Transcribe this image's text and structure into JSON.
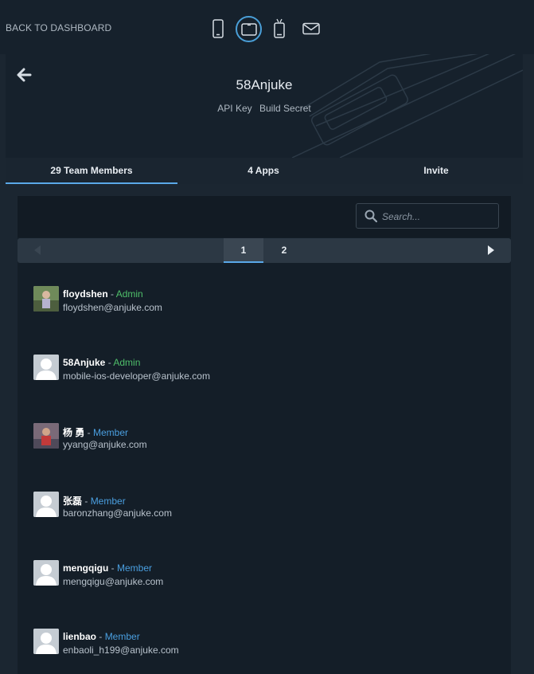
{
  "topbar": {
    "back_label": "BACK TO DASHBOARD",
    "device_icons": [
      "phone-icon",
      "tablet-icon",
      "android-icon",
      "mail-icon"
    ],
    "active_device": "tablet-icon"
  },
  "app": {
    "title": "58Anjuke",
    "api_key_label": "API Key",
    "build_secret_label": "Build Secret"
  },
  "tabs": [
    {
      "label": "29 Team Members",
      "active": true
    },
    {
      "label": "4 Apps",
      "active": false
    },
    {
      "label": "Invite",
      "active": false
    }
  ],
  "search": {
    "placeholder": "Search..."
  },
  "pagination": {
    "pages": [
      "1",
      "2"
    ],
    "current": "1"
  },
  "members": [
    {
      "name": "floydshen",
      "separator": " - ",
      "role": "Admin",
      "email": "floydshen@anjuke.com",
      "avatar": "photo"
    },
    {
      "name": "58Anjuke",
      "separator": " - ",
      "role": "Admin",
      "email": "mobile-ios-developer@anjuke.com",
      "avatar": "default"
    },
    {
      "name": "杨 勇",
      "separator": " - ",
      "role": "Member",
      "email": "yyang@anjuke.com",
      "avatar": "photo"
    },
    {
      "name": "张磊",
      "separator": " - ",
      "role": "Member",
      "email": "baronzhang@anjuke.com",
      "avatar": "default"
    },
    {
      "name": "mengqigu",
      "separator": " - ",
      "role": "Member",
      "email": "mengqigu@anjuke.com",
      "avatar": "default"
    },
    {
      "name": "lienbao",
      "separator": " - ",
      "role": "Member",
      "email": "enbaoli_h199@anjuke.com",
      "avatar": "default"
    }
  ],
  "colors": {
    "admin": "#4fbf6a",
    "member": "#4a9fe0",
    "accent": "#5aa8e8",
    "background": "#1b2631"
  }
}
